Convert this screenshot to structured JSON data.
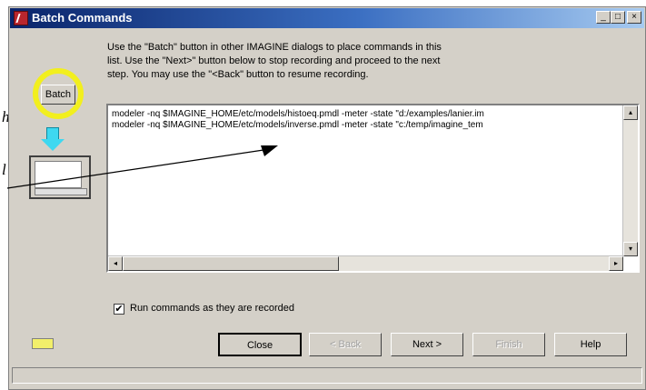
{
  "window": {
    "title": "Batch Commands",
    "controls": {
      "minimize": "_",
      "maximize": "□",
      "close": "×"
    }
  },
  "left_panel": {
    "batch_button_label": "Batch"
  },
  "instructions": "Use the \"Batch\" button in other IMAGINE dialogs to place commands in this\nlist. Use the \"Next>\" button below to stop recording and proceed to the next\nstep. You may use the \"<Back\" button to resume recording.",
  "commands": [
    "modeler -nq $IMAGINE_HOME/etc/models/histoeq.pmdl -meter -state \"d:/examples/lanier.im",
    "modeler -nq $IMAGINE_HOME/etc/models/inverse.pmdl -meter -state \"c:/temp/imagine_tem"
  ],
  "run_option": {
    "label": "Run commands as they are recorded",
    "checked": true
  },
  "buttons": {
    "close": "Close",
    "back": "< Back",
    "next": "Next >",
    "finish": "Finish",
    "help": "Help"
  },
  "margin_fragments": [
    "h",
    "l"
  ],
  "icons": {
    "app": "imagine-app-icon",
    "arrow": "down-arrow-icon",
    "list": "list-icon",
    "scroll_left": "◂",
    "scroll_right": "▸",
    "scroll_up": "▴",
    "scroll_down": "▾",
    "check": "✔"
  },
  "colors": {
    "highlight_ring": "#f2ef1e",
    "arrow": "#3ed8f0",
    "status_led": "#f2ef6a",
    "titlebar": "#0a246a"
  }
}
